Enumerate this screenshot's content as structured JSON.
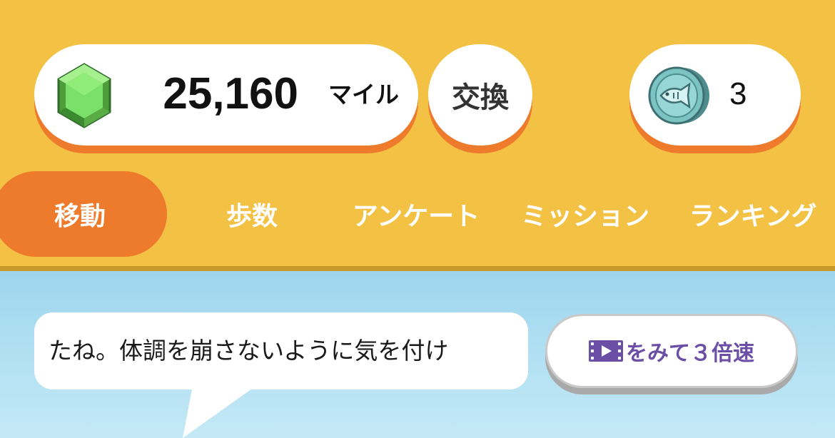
{
  "header": {
    "miles": {
      "value": "25,160",
      "unit": "マイル",
      "icon": "emerald-gem-icon"
    },
    "exchange_label": "交換",
    "coins": {
      "value": "3",
      "icon": "fish-coin-icon"
    }
  },
  "tabs": [
    {
      "label": "移動",
      "active": true
    },
    {
      "label": "歩数",
      "active": false
    },
    {
      "label": "アンケート",
      "active": false
    },
    {
      "label": "ミッション",
      "active": false
    },
    {
      "label": "ランキング",
      "active": false
    }
  ],
  "speech_bubble": {
    "text": "たね。体調を崩さないように気を付け"
  },
  "video_button": {
    "label": "をみて３倍速",
    "icon": "film-icon"
  },
  "colors": {
    "background": "#f3c244",
    "accent": "#ee7b2c",
    "sky": "#a6daf0",
    "video_label": "#6b4ea6"
  }
}
